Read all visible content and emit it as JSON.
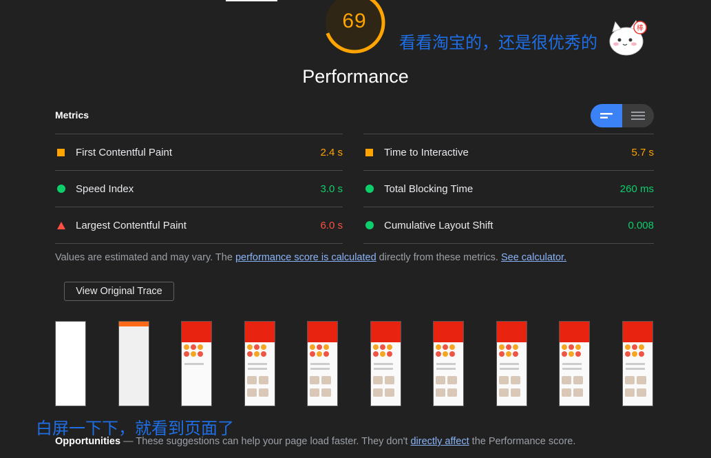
{
  "score": {
    "value": "69",
    "fraction": 0.69,
    "color": "#ffa400"
  },
  "annotations": {
    "top": "看看淘宝的，还是很优秀的",
    "bottom": "白屏一下下，就看到页面了",
    "sticker_text": "棒"
  },
  "category_title": "Performance",
  "metrics_label": "Metrics",
  "metrics_left": [
    {
      "label": "First Contentful Paint",
      "value": "2.4 s",
      "status": "average"
    },
    {
      "label": "Speed Index",
      "value": "3.0 s",
      "status": "pass"
    },
    {
      "label": "Largest Contentful Paint",
      "value": "6.0 s",
      "status": "fail"
    }
  ],
  "metrics_right": [
    {
      "label": "Time to Interactive",
      "value": "5.7 s",
      "status": "average"
    },
    {
      "label": "Total Blocking Time",
      "value": "260 ms",
      "status": "pass"
    },
    {
      "label": "Cumulative Layout Shift",
      "value": "0.008",
      "status": "pass"
    }
  ],
  "note": {
    "part1": "Values are estimated and may vary. The ",
    "link1": "performance score is calculated",
    "part2": " directly from these metrics. ",
    "link2": "See calculator."
  },
  "trace_button": "View Original Trace",
  "opportunities": {
    "title": "Opportunities",
    "part1": " — These suggestions can help your page load faster. They don't ",
    "link": "directly affect",
    "part2": " the Performance score."
  },
  "colors": {
    "average": "#ffa400",
    "pass": "#0cce6b",
    "fail": "#ff4e42",
    "link": "#8ab4f8",
    "annotation": "#1e6fe6"
  }
}
